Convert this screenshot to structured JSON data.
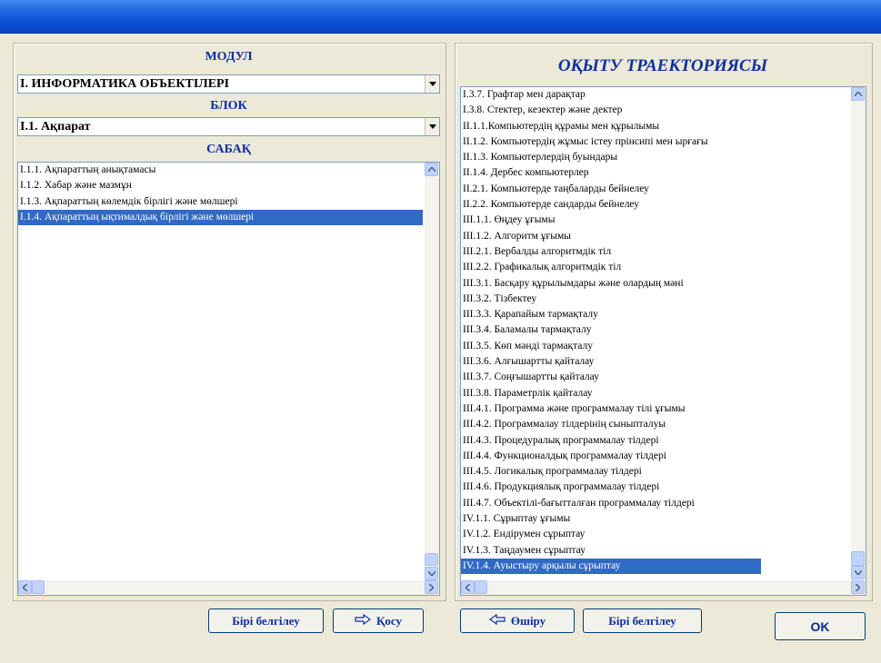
{
  "colors": {
    "heading": "#0d2ea2",
    "selection": "#316ac5",
    "titlebar": "#0f54d8"
  },
  "left": {
    "module_heading": "МОДУЛ",
    "module_value": "І.  ИНФОРМАТИКА ОБЪЕКТІЛЕРІ",
    "block_heading": "БЛОК",
    "block_value": "І.1. Ақпарат",
    "lesson_heading": "САБАҚ",
    "lessons": [
      "І.1.1. Ақпараттың анықтамасы",
      "І.1.2. Хабар және мазмұн",
      "І.1.3. Ақпараттың көлемдік бірлігі және мөлшері",
      "І.1.4. Ақпараттың ықтималдық бірлігі және мөлшері"
    ],
    "selected_lesson": "І.1.4. Ақпараттың ықтималдық бірлігі және мөлшері"
  },
  "right": {
    "heading": "ОҚЫТУ ТРАЕКТОРИЯСЫ",
    "items": [
      "І.3.7. Графтар мен дарақтар",
      "І.3.8. Стектер, кезектер және дектер",
      "ІІ.1.1.Компьютердің құрамы мен құрылымы",
      "ІІ.1.2. Компьютердің жұмыс істеу прінсипі мен ырғағы",
      "ІІ.1.3.  Компьютерлердің буындары",
      "ІІ.1.4. Дербес компьютерлер",
      "ІІ.2.1. Компьютерде таңбаларды бейнелеу",
      "ІІ.2.2. Компьютерде сандарды бейнелеу",
      "ІІІ.1.1. Өңдеу ұғымы",
      "ІІІ.1.2. Алгоритм ұғымы",
      "ІІІ.2.1. Вербалды алгоритмдік тіл",
      "ІІІ.2.2. Графикалық алгоритмдік тіл",
      "ІІІ.3.1. Басқару құрылымдары және олардың мәні",
      "ІІІ.3.2. Тізбектеу",
      "ІІІ.3.3. Қарапайым тармақталу",
      "ІІІ.3.4. Баламалы тармақталу",
      "ІІІ.3.5. Көп мәнді тармақталу",
      "ІІІ.3.6. Алғышартты қайталау",
      "ІІІ.3.7. Соңғышартты қайталау",
      "ІІІ.3.8. Параметрлік қайталау",
      "ІІІ.4.1. Программа және программалау тілі ұғымы",
      "ІІІ.4.2. Программалау тілдерінің сынып­талуы",
      "ІІІ.4.3. Процедуралық программалау тілдері",
      "ІІІ.4.4. Функционалдық программалау тілдері",
      "ІІІ.4.5. Логикалық программалау тілдері",
      "ІІІ.4.6. Продукциялық программалау тілдері",
      "ІІІ.4.7. Объектілі-бағытталған программалау тілдері",
      "ІV.1.1. Сұрыптау ұғымы",
      "ІV.1.2. Ендірумен сұрыптау",
      "ІV.1.3.  Таңдаумен сұрыптау",
      "ІV.1.4.  Ауыстыру арқылы сұрыптау"
    ],
    "selected_item": "ІV.1.4.  Ауыстыру арқылы сұрыптау"
  },
  "buttons": {
    "mark_one_left": "Бірі белгілеу",
    "add": "Қосу",
    "delete": "Өшіру",
    "mark_one_right": "Бірі белгілеу",
    "ok": "OK"
  }
}
